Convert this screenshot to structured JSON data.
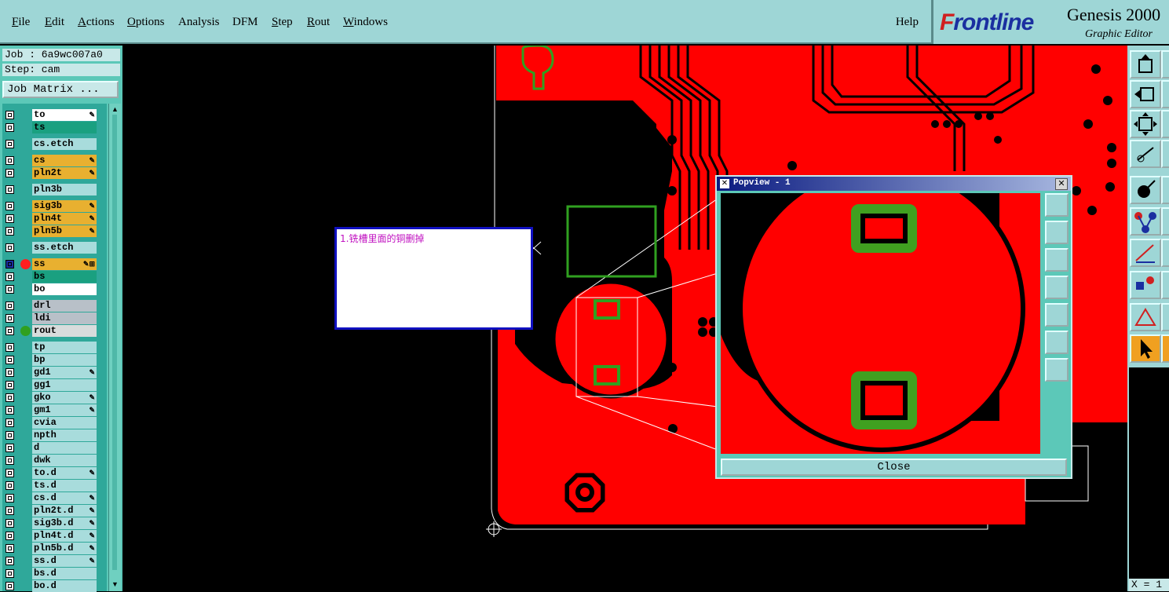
{
  "menu": {
    "items": [
      {
        "label": "File",
        "u": "F"
      },
      {
        "label": "Edit",
        "u": "E"
      },
      {
        "label": "Actions",
        "u": "A"
      },
      {
        "label": "Options",
        "u": "O"
      },
      {
        "label": "Analysis",
        "u": ""
      },
      {
        "label": "DFM",
        "u": ""
      },
      {
        "label": "Step",
        "u": "S"
      },
      {
        "label": "Rout",
        "u": "R"
      },
      {
        "label": "Windows",
        "u": "W"
      }
    ],
    "help": "Help"
  },
  "brand": {
    "logo_first": "F",
    "logo_rest": "rontline",
    "product": "Genesis 2000",
    "subtitle": "Graphic Editor"
  },
  "job": {
    "job_label": "Job : 6a9wc007a0",
    "step_label": "Step: cam",
    "matrix_button": "Job Matrix ..."
  },
  "layers": [
    {
      "name": "to",
      "color": "#ffffff",
      "mk": "✎",
      "dot": ""
    },
    {
      "name": "ts",
      "color": "#1aa080",
      "mk": "",
      "dot": ""
    },
    {
      "name": "cs.etch",
      "color": "#a8dcdc",
      "mk": "",
      "dot": ""
    },
    {
      "name": "cs",
      "color": "#e8b030",
      "mk": "✎",
      "dot": ""
    },
    {
      "name": "pln2t",
      "color": "#e8b030",
      "mk": "✎",
      "dot": ""
    },
    {
      "name": "pln3b",
      "color": "#a8dcdc",
      "mk": "",
      "dot": ""
    },
    {
      "name": "sig3b",
      "color": "#e8b030",
      "mk": "✎",
      "dot": ""
    },
    {
      "name": "pln4t",
      "color": "#e8b030",
      "mk": "✎",
      "dot": ""
    },
    {
      "name": "pln5b",
      "color": "#e8b030",
      "mk": "✎",
      "dot": ""
    },
    {
      "name": "ss.etch",
      "color": "#a8dcdc",
      "mk": "",
      "dot": ""
    },
    {
      "name": "ss",
      "color": "#e8b030",
      "mk": "✎⊞",
      "dot": "#ff2020"
    },
    {
      "name": "bs",
      "color": "#1aa080",
      "mk": "",
      "dot": ""
    },
    {
      "name": "bo",
      "color": "#ffffff",
      "mk": "",
      "dot": ""
    },
    {
      "name": "drl",
      "color": "#b8c0c8",
      "mk": "",
      "dot": ""
    },
    {
      "name": "ldi",
      "color": "#b8c0c8",
      "mk": "",
      "dot": ""
    },
    {
      "name": "rout",
      "color": "#d8dcdc",
      "mk": "",
      "dot": "#30a020"
    },
    {
      "name": "tp",
      "color": "#a8dcdc",
      "mk": "",
      "dot": ""
    },
    {
      "name": "bp",
      "color": "#a8dcdc",
      "mk": "",
      "dot": ""
    },
    {
      "name": "gd1",
      "color": "#a8dcdc",
      "mk": "✎",
      "dot": ""
    },
    {
      "name": "gg1",
      "color": "#a8dcdc",
      "mk": "",
      "dot": ""
    },
    {
      "name": "gko",
      "color": "#a8dcdc",
      "mk": "✎",
      "dot": ""
    },
    {
      "name": "gm1",
      "color": "#a8dcdc",
      "mk": "✎",
      "dot": ""
    },
    {
      "name": "cvia",
      "color": "#a8dcdc",
      "mk": "",
      "dot": ""
    },
    {
      "name": "npth",
      "color": "#a8dcdc",
      "mk": "",
      "dot": ""
    },
    {
      "name": "d",
      "color": "#a8dcdc",
      "mk": "",
      "dot": ""
    },
    {
      "name": "dwk",
      "color": "#a8dcdc",
      "mk": "",
      "dot": ""
    },
    {
      "name": "to.d",
      "color": "#a8dcdc",
      "mk": "✎",
      "dot": ""
    },
    {
      "name": "ts.d",
      "color": "#a8dcdc",
      "mk": "",
      "dot": ""
    },
    {
      "name": "cs.d",
      "color": "#a8dcdc",
      "mk": "✎",
      "dot": ""
    },
    {
      "name": "pln2t.d",
      "color": "#a8dcdc",
      "mk": "✎",
      "dot": ""
    },
    {
      "name": "sig3b.d",
      "color": "#a8dcdc",
      "mk": "✎",
      "dot": ""
    },
    {
      "name": "pln4t.d",
      "color": "#a8dcdc",
      "mk": "✎",
      "dot": ""
    },
    {
      "name": "pln5b.d",
      "color": "#a8dcdc",
      "mk": "✎",
      "dot": ""
    },
    {
      "name": "ss.d",
      "color": "#a8dcdc",
      "mk": "✎",
      "dot": ""
    },
    {
      "name": "bs.d",
      "color": "#a8dcdc",
      "mk": "",
      "dot": ""
    },
    {
      "name": "bo.d",
      "color": "#a8dcdc",
      "mk": "",
      "dot": ""
    }
  ],
  "note": {
    "text": "1.铣槽里面的铜删掉"
  },
  "popview": {
    "title": "Popview - 1",
    "close_label": "Close"
  },
  "coord": {
    "text": "X = 1"
  },
  "colors": {
    "copper": "#ff0000",
    "pad": "#40a020",
    "panel": "#9ed6d6"
  }
}
